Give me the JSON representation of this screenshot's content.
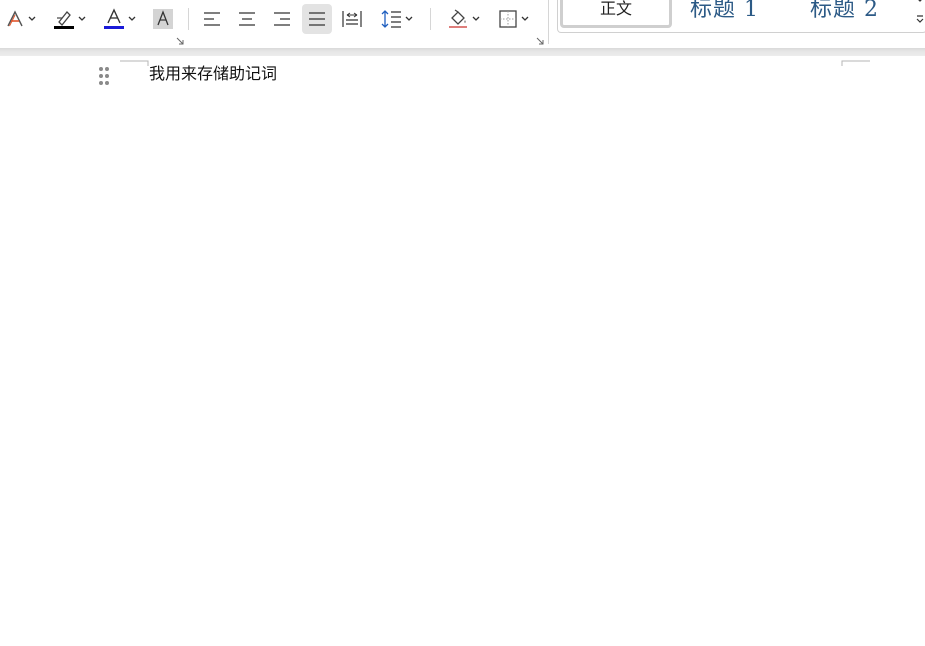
{
  "colors": {
    "highlight": "#000000",
    "font_color": "#1a1ad8",
    "style_heading": "#2c5a86"
  },
  "toolbar": {
    "icons": [
      "text-effects-icon",
      "highlight-icon",
      "font-color-icon",
      "char-shading-icon",
      "align-left-icon",
      "align-center-icon",
      "align-right-icon",
      "justify-icon",
      "distributed-icon",
      "line-spacing-icon",
      "shading-fill-icon",
      "borders-icon"
    ]
  },
  "styles": {
    "normal": "正文",
    "heading1": "标题 1",
    "heading2": "标题 2"
  },
  "document": {
    "paragraph": "我用来存储助记词"
  }
}
